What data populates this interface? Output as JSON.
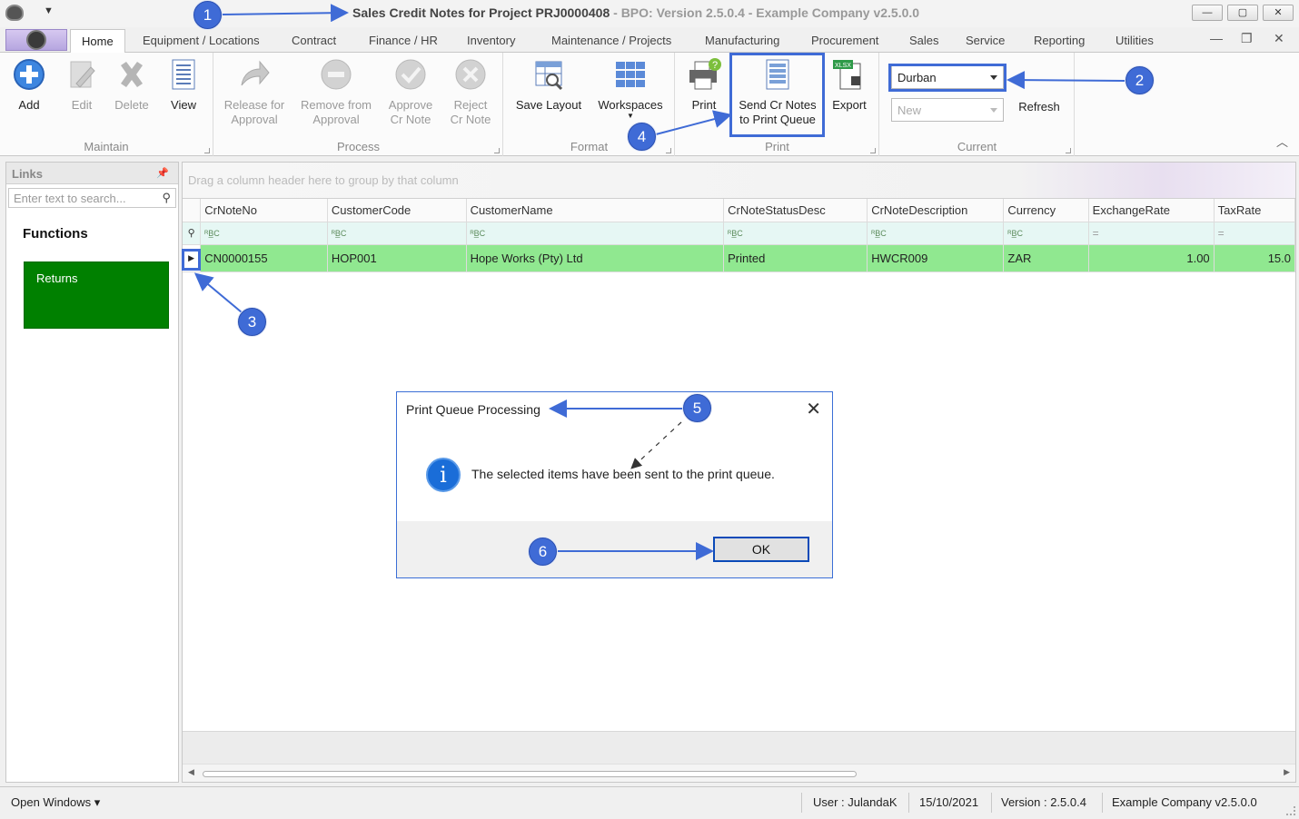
{
  "window": {
    "title": "Sales Credit Notes for Project PRJ0000408",
    "subtitle": "- BPO: Version 2.5.0.4 - Example Company v2.5.0.0",
    "minimize": "—",
    "restore": "▢",
    "close": "✕"
  },
  "tabs": {
    "home": "Home",
    "equipment": "Equipment / Locations",
    "contract": "Contract",
    "finance": "Finance / HR",
    "inventory": "Inventory",
    "maintenance": "Maintenance / Projects",
    "manufacturing": "Manufacturing",
    "procurement": "Procurement",
    "sales": "Sales",
    "service": "Service",
    "reporting": "Reporting",
    "utilities": "Utilities"
  },
  "ribbon": {
    "maintain": {
      "label": "Maintain",
      "add": "Add",
      "edit": "Edit",
      "delete": "Delete",
      "view": "View"
    },
    "process": {
      "label": "Process",
      "release_l1": "Release for",
      "release_l2": "Approval",
      "remove_l1": "Remove from",
      "remove_l2": "Approval",
      "approve_l1": "Approve",
      "approve_l2": "Cr Note",
      "reject_l1": "Reject",
      "reject_l2": "Cr Note"
    },
    "format": {
      "label": "Format",
      "save_layout": "Save Layout",
      "workspaces": "Workspaces"
    },
    "print": {
      "label": "Print",
      "print": "Print",
      "send_l1": "Send Cr Notes",
      "send_l2": "to Print Queue",
      "export": "Export",
      "export_badge": "XLSX"
    },
    "current": {
      "label": "Current",
      "site": "Durban",
      "status": "New",
      "refresh": "Refresh"
    }
  },
  "links": {
    "header": "Links",
    "search_placeholder": "Enter text to search...",
    "functions_title": "Functions",
    "returns": "Returns"
  },
  "grid": {
    "group_hint": "Drag a column header here to group by that column",
    "columns": [
      "CrNoteNo",
      "CustomerCode",
      "CustomerName",
      "CrNoteStatusDesc",
      "CrNoteDescription",
      "Currency",
      "ExchangeRate",
      "TaxRate"
    ],
    "filter_text_glyph": "ᴿB̲C",
    "filter_num_glyph": "=",
    "rows": [
      {
        "CrNoteNo": "CN0000155",
        "CustomerCode": "HOP001",
        "CustomerName": "Hope Works (Pty) Ltd",
        "CrNoteStatusDesc": "Printed",
        "CrNoteDescription": "HWCR009",
        "Currency": "ZAR",
        "ExchangeRate": "1.00",
        "TaxRate": "15.0"
      }
    ]
  },
  "dialog": {
    "title": "Print Queue Processing",
    "message": "The selected items have been sent to the print queue.",
    "ok": "OK",
    "close": "✕"
  },
  "statusbar": {
    "open_windows": "Open Windows ▾",
    "user": "User : JulandaK",
    "date": "15/10/2021",
    "version": "Version : 2.5.0.4",
    "company": "Example Company v2.5.0.0"
  },
  "callouts": [
    "1",
    "2",
    "3",
    "4",
    "5",
    "6"
  ],
  "colors": {
    "accent": "#3f6bd6",
    "selected_row": "#90e890",
    "returns_tile": "#008000",
    "filter_row": "#e6f7f4"
  }
}
